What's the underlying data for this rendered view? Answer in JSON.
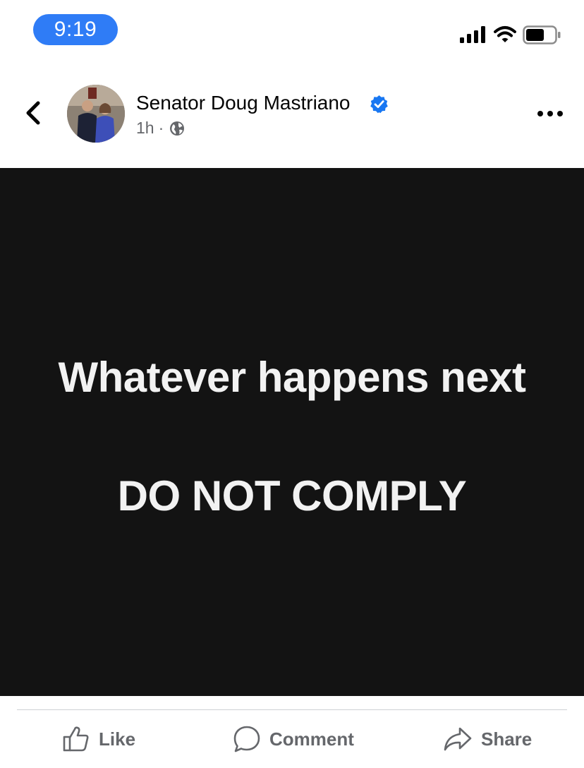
{
  "status_bar": {
    "time": "9:19",
    "icons": [
      "signal-icon",
      "wifi-icon",
      "battery-icon"
    ],
    "accent": "#2f7cf6"
  },
  "post": {
    "author": "Senator Doug Mastriano",
    "verified_icon": "verified-badge-icon",
    "time_ago": "1h",
    "separator": "·",
    "audience_icon": "globe-icon",
    "image": {
      "line1": "Whatever happens next",
      "line2": "DO NOT COMPLY",
      "background": "#131313",
      "text_color": "#f2f2f2"
    }
  },
  "actions": {
    "like": "Like",
    "comment": "Comment",
    "share": "Share"
  },
  "colors": {
    "verified": "#1877f2",
    "secondary_text": "#65676b"
  }
}
